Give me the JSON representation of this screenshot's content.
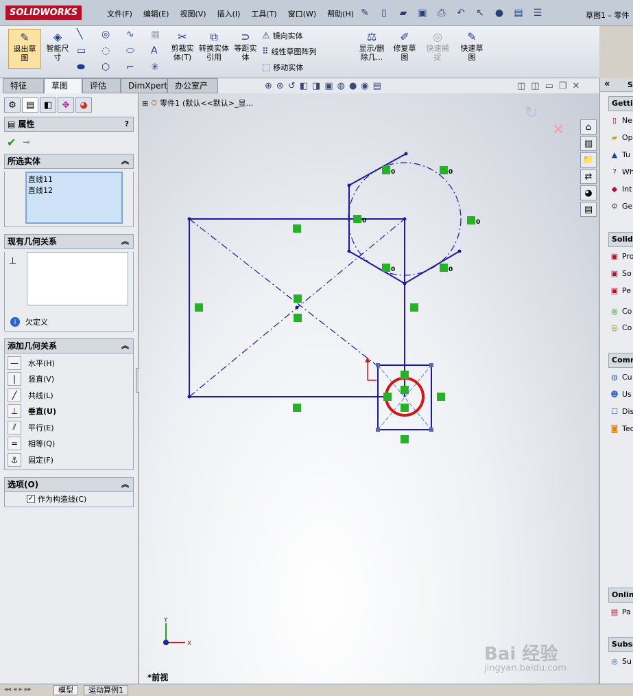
{
  "app": {
    "logo": "SOLIDWORKS",
    "doc_title": "草图1 – 零件"
  },
  "menu": [
    "文件(F)",
    "编辑(E)",
    "视图(V)",
    "插入(I)",
    "工具(T)",
    "窗口(W)",
    "帮助(H)"
  ],
  "ribbon": {
    "exit_sketch": "退出草图",
    "smart_dim": "智能尺寸",
    "trim": "剪裁实体(T)",
    "convert": "转换实体引用",
    "offset": "等距实体",
    "mirror": "镜向实体",
    "linear_pattern": "线性草图阵列",
    "move": "移动实体",
    "display_delete": "显示/删除几...",
    "repair": "修复草图",
    "quick_snap": "快速捕捉",
    "rapid_sketch": "快速草图"
  },
  "cmd_tabs": [
    "特征",
    "草图",
    "评估",
    "DimXpert",
    "办公室产品"
  ],
  "tree": {
    "part": "零件1",
    "config": "(默认<<默认>_显..."
  },
  "property_manager": {
    "title": "属性",
    "selected_title": "所选实体",
    "selected_items": [
      "直线11",
      "直线12"
    ],
    "existing_title": "现有几何关系",
    "status": "欠定义",
    "add_title": "添加几何关系",
    "relations": [
      "水平(H)",
      "竖直(V)",
      "共线(L)",
      "垂直(U)",
      "平行(E)",
      "相等(Q)",
      "固定(F)"
    ],
    "options_title": "选项(O)",
    "construction": "作为构造线(C)"
  },
  "view_label": "*前视",
  "triad": {
    "x": "X",
    "y": "Y"
  },
  "dim_tag": "0",
  "right_panel": {
    "getting_title": "Gettin",
    "getting_items": [
      "Ne",
      "Op",
      "Tu",
      "Wh",
      "Int",
      "Ge"
    ],
    "solidworks_title": "SolidW",
    "solidworks_items": [
      "Pro",
      "So",
      "Pe",
      "Co",
      "Co"
    ],
    "community_title": "Comm",
    "community_items": [
      "Cu",
      "Us",
      "Dis",
      "Tec"
    ],
    "online_title": "Online",
    "online_items": [
      "Pa"
    ],
    "subscr_title": "Subscr",
    "subscr_items": [
      "Su"
    ],
    "tab_letter": "S"
  },
  "bottom_tabs": [
    "模型",
    "运动算例1"
  ],
  "watermark": {
    "brand": "Bai 经验",
    "url": "jingyan.baidu.com"
  }
}
